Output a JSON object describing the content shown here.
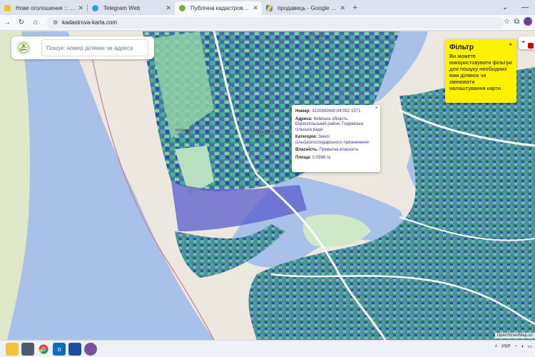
{
  "browser": {
    "tabs": [
      {
        "title": "Нове оголошення :: Rieltor.ua",
        "favicon_color": "#f5c518"
      },
      {
        "title": "Telegram Web",
        "favicon_color": "#2aa3e0"
      },
      {
        "title": "Публічна кадастрова карта Ук",
        "favicon_color": "#6fb53c"
      },
      {
        "title": "продавець - Google Диск",
        "favicon_color": "#1fa463"
      }
    ],
    "address": "kadastrova-karta.com",
    "profile_initial": "Д"
  },
  "search": {
    "placeholder": "Пошук: номер ділянки чи адреса"
  },
  "popup": {
    "number_label": "Номер:",
    "number_value": "3220882600:04:002:1571",
    "address_label": "Адреса:",
    "address_value": "Київська область, Бориспільський район, Гнідинська сільська рада",
    "category_label": "Категорія:",
    "category_value": "Землі сільськогосподарського призначення",
    "ownership_label": "Власність:",
    "ownership_value": "Приватна власність",
    "area_label": "Площа:",
    "area_value": "0.0598 га"
  },
  "filter_tip": {
    "title": "Фільтр",
    "body": "Ви можете використовувати фільтри для пошуку необхідних вам ділянок чи змінювати налаштування карти."
  },
  "map": {
    "attribution": "OpenStreetMap.co",
    "place_labels": [
      "Мокиньо",
      "Рибацький острів",
      "Гнідин"
    ]
  },
  "taskbar": {
    "lang": "УКР"
  },
  "colors": {
    "water": "#a9c1e9",
    "parcel_teal": "#3f9e8f",
    "parcel_blue": "#5a5ccc",
    "parcel_light": "#8fc9b8",
    "filter_yellow": "#fff200"
  }
}
